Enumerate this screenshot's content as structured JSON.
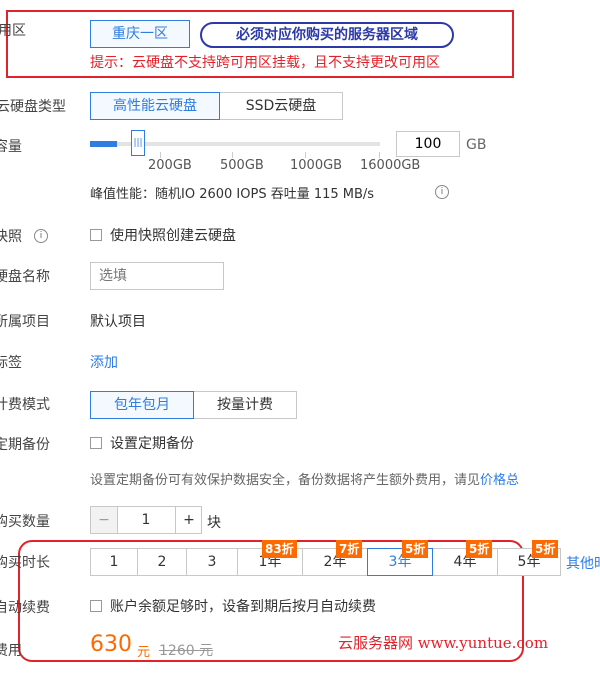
{
  "zone": {
    "label": "可用区",
    "selected": "重庆一区",
    "callout": "必须对应你购买的服务器区域",
    "hint": "提示：云硬盘不支持跨可用区挂载，且不支持更改可用区"
  },
  "disk_type": {
    "label": "云硬盘类型",
    "options": [
      "高性能云硬盘",
      "SSD云硬盘"
    ],
    "selected": "高性能云硬盘"
  },
  "capacity": {
    "label": "容量",
    "value": "100",
    "unit": "GB",
    "slider_ticks": [
      "200GB",
      "500GB",
      "1000GB",
      "16000GB"
    ],
    "slider_level": 0.06,
    "perf_text": "峰值性能：随机IO 2600 IOPS  吞吐量 115 MB/s",
    "info_icon": "info-icon"
  },
  "snapshot": {
    "label": "快照",
    "checkbox_label": "使用快照创建云硬盘",
    "info_icon": "info-icon"
  },
  "disk_name": {
    "label": "硬盘名称",
    "placeholder": "选填"
  },
  "project": {
    "label": "所属项目",
    "value": "默认项目"
  },
  "tags": {
    "label": "标签",
    "add_link": "添加"
  },
  "billing": {
    "label": "计费模式",
    "options": [
      "包年包月",
      "按量计费"
    ],
    "selected": "包年包月"
  },
  "backup": {
    "label": "定期备份",
    "checkbox_label": "设置定期备份",
    "desc": "设置定期备份可有效保护数据安全，备份数据将产生额外费用，请见",
    "desc_link": "价格总"
  },
  "quantity": {
    "label": "购买数量",
    "minus": "−",
    "value": "1",
    "plus": "+",
    "unit": "块"
  },
  "duration": {
    "label": "购买时长",
    "options": [
      "1",
      "2",
      "3",
      "1年",
      "2年",
      "3年",
      "4年",
      "5年"
    ],
    "selected": "3年",
    "badges": [
      "83折",
      "7折",
      "5折",
      "5折",
      "5折"
    ],
    "other_link": "其他时"
  },
  "auto_renew": {
    "label": "自动续费",
    "checkbox_label": "账户余额足够时，设备到期后按月自动续费"
  },
  "fee": {
    "label": "费用",
    "price": "630",
    "unit": "元",
    "original": "1260 元"
  },
  "watermark": "云服务器网 www.yuntue.com",
  "colors": {
    "accent": "#2f7de1",
    "price": "#ff6a00",
    "annotation_red": "#e2222a",
    "callout_border": "#2b3aa8"
  }
}
